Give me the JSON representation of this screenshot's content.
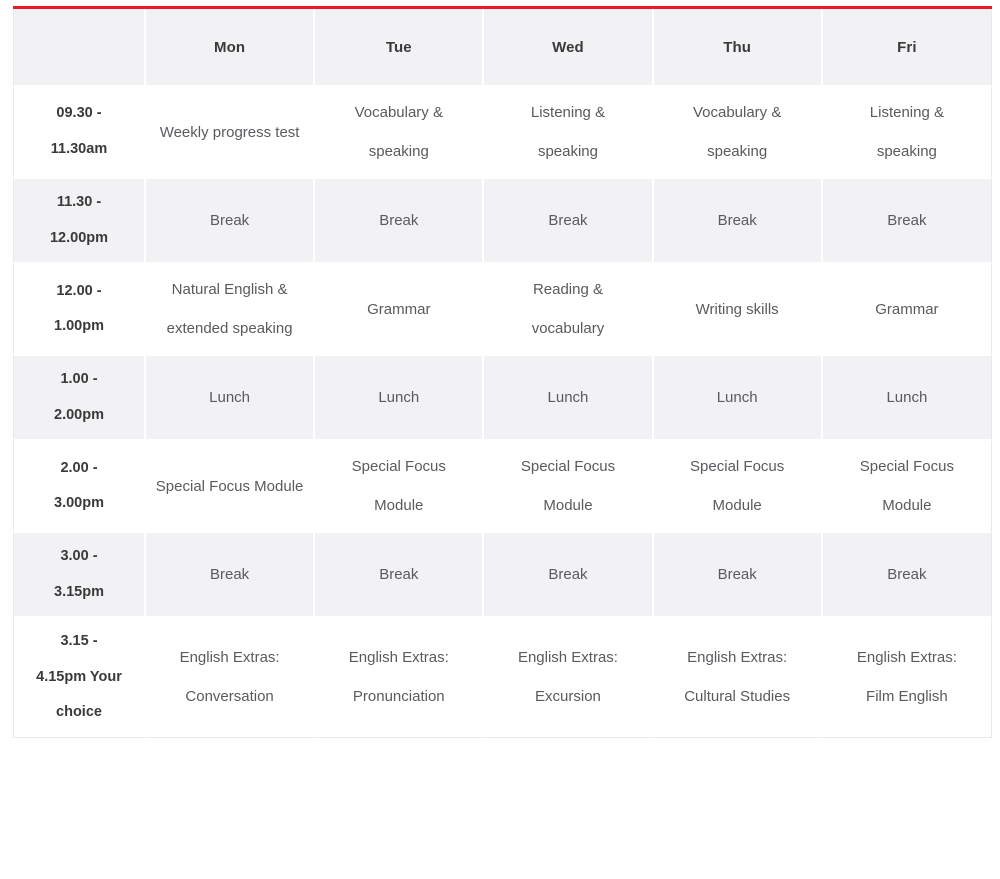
{
  "theme": {
    "accent_top_border": "#ed1c24",
    "header_background": "#f2f2f4",
    "row_alt_background": "#f2f2f4",
    "row_background": "#ffffff",
    "header_text_color": "#3a3a3a",
    "body_text_color": "#5a5a5f"
  },
  "timetable": {
    "corner_label": "",
    "day_headers": [
      "Mon",
      "Tue",
      "Wed",
      "Thu",
      "Fri"
    ],
    "rows": [
      {
        "shade": "white",
        "time": [
          "09.30 -",
          "11.30am"
        ],
        "cells": [
          [
            "Weekly progress test"
          ],
          [
            "Vocabulary &",
            "speaking"
          ],
          [
            "Listening &",
            "speaking"
          ],
          [
            "Vocabulary &",
            "speaking"
          ],
          [
            "Listening &",
            "speaking"
          ]
        ]
      },
      {
        "shade": "grey",
        "time": [
          "11.30 -",
          "12.00pm"
        ],
        "cells": [
          [
            "Break"
          ],
          [
            "Break"
          ],
          [
            "Break"
          ],
          [
            "Break"
          ],
          [
            "Break"
          ]
        ]
      },
      {
        "shade": "white",
        "time": [
          "12.00 -",
          "1.00pm"
        ],
        "cells": [
          [
            "Natural English &",
            "extended speaking"
          ],
          [
            "Grammar"
          ],
          [
            "Reading &",
            "vocabulary"
          ],
          [
            "Writing skills"
          ],
          [
            "Grammar"
          ]
        ]
      },
      {
        "shade": "grey",
        "time": [
          "1.00 -",
          "2.00pm"
        ],
        "cells": [
          [
            "Lunch"
          ],
          [
            "Lunch"
          ],
          [
            "Lunch"
          ],
          [
            "Lunch"
          ],
          [
            "Lunch"
          ]
        ]
      },
      {
        "shade": "white",
        "time": [
          "2.00 -",
          "3.00pm"
        ],
        "cells": [
          [
            "Special Focus Module"
          ],
          [
            "Special Focus",
            "Module"
          ],
          [
            "Special Focus",
            "Module"
          ],
          [
            "Special Focus",
            "Module"
          ],
          [
            "Special Focus",
            "Module"
          ]
        ]
      },
      {
        "shade": "grey",
        "time": [
          "3.00 -",
          "3.15pm"
        ],
        "cells": [
          [
            "Break"
          ],
          [
            "Break"
          ],
          [
            "Break"
          ],
          [
            "Break"
          ],
          [
            "Break"
          ]
        ]
      },
      {
        "shade": "white",
        "time": [
          "3.15 -",
          "4.15pm Your",
          "choice"
        ],
        "cells": [
          [
            "English Extras:",
            "Conversation"
          ],
          [
            "English Extras:",
            "Pronunciation"
          ],
          [
            "English Extras:",
            "Excursion"
          ],
          [
            "English Extras:",
            "Cultural Studies"
          ],
          [
            "English Extras:",
            "Film English"
          ]
        ]
      }
    ]
  }
}
